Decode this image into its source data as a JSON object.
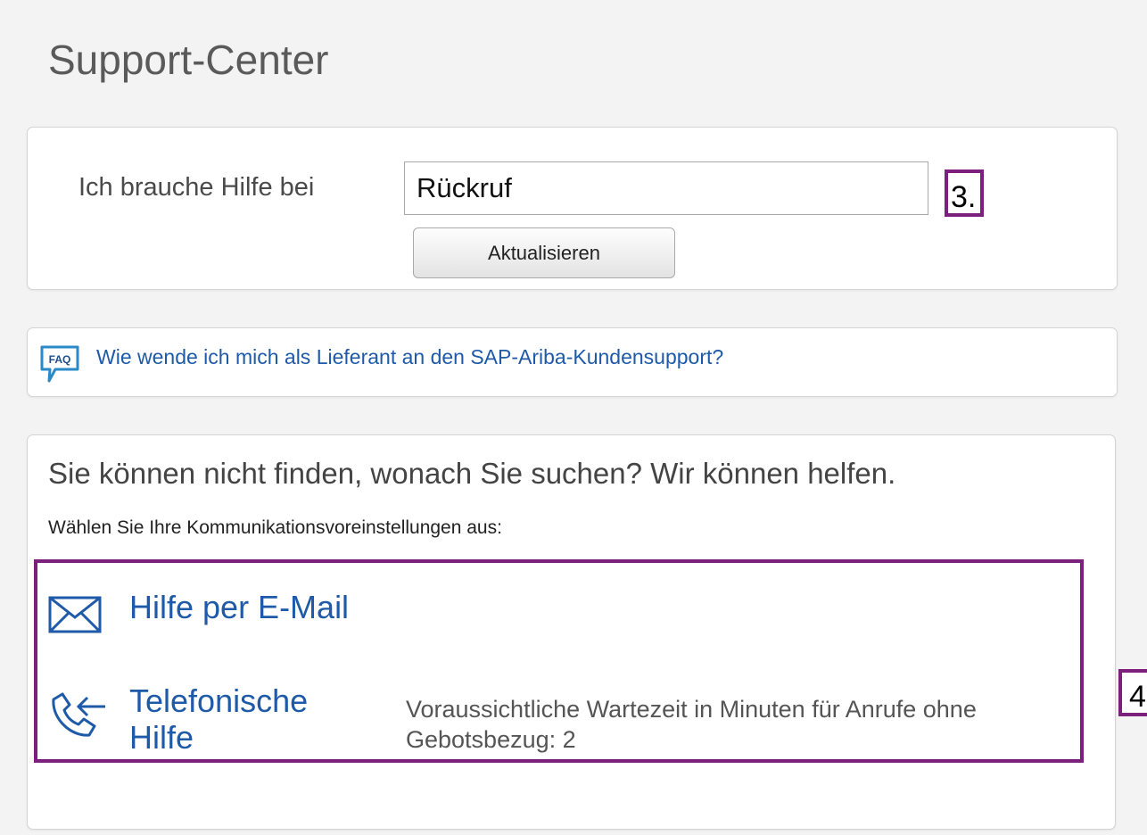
{
  "page": {
    "title": "Support-Center"
  },
  "search": {
    "label": "Ich brauche Hilfe bei",
    "value": "Rückruf",
    "update_button": "Aktualisieren"
  },
  "callouts": {
    "step3": "3.",
    "step4": "4"
  },
  "faq": {
    "icon": "faq-icon",
    "icon_text": "FAQ",
    "link": "Wie wende ich mich als Lieferant an den SAP-Ariba-Kundensupport?"
  },
  "help": {
    "heading": "Sie können nicht finden, wonach Sie suchen? Wir können helfen.",
    "subheading": "Wählen Sie Ihre Kommunikationsvoreinstellungen aus:",
    "options": [
      {
        "icon": "mail-icon",
        "label": "Hilfe per E-Mail"
      },
      {
        "icon": "phone-callback-icon",
        "label": "Telefonische Hilfe",
        "detail": "Voraussichtliche Wartezeit in Minuten für Anrufe ohne Gebotsbezug: 2"
      }
    ]
  },
  "colors": {
    "link": "#1e5aa8",
    "callout_border": "#7d1f7d",
    "background": "#f3f3f3"
  }
}
